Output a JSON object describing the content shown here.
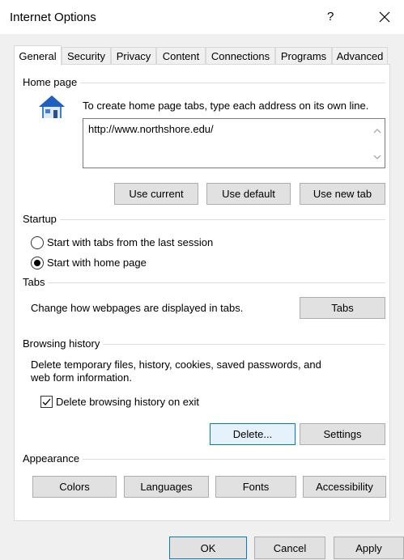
{
  "window": {
    "title": "Internet Options",
    "help_label": "?"
  },
  "tabs": [
    {
      "label": "General",
      "active": true
    },
    {
      "label": "Security"
    },
    {
      "label": "Privacy"
    },
    {
      "label": "Content"
    },
    {
      "label": "Connections"
    },
    {
      "label": "Programs"
    },
    {
      "label": "Advanced"
    }
  ],
  "home_page": {
    "group_label": "Home page",
    "instructions": "To create home page tabs, type each address on its own line.",
    "address_value": "http://www.northshore.edu/",
    "use_current": "Use current",
    "use_default": "Use default",
    "use_new_tab": "Use new tab"
  },
  "startup": {
    "group_label": "Startup",
    "option_last_session": "Start with tabs from the last session",
    "option_home_page": "Start with home page",
    "selected": "home_page"
  },
  "tabs_section": {
    "group_label": "Tabs",
    "description": "Change how webpages are displayed in tabs.",
    "button": "Tabs"
  },
  "browsing_history": {
    "group_label": "Browsing history",
    "description_line1": "Delete temporary files, history, cookies, saved passwords, and",
    "description_line2": "web form information.",
    "delete_on_exit_label": "Delete browsing history on exit",
    "delete_on_exit_checked": true,
    "delete_button": "Delete...",
    "settings_button": "Settings"
  },
  "appearance": {
    "group_label": "Appearance",
    "colors": "Colors",
    "languages": "Languages",
    "fonts": "Fonts",
    "accessibility": "Accessibility"
  },
  "footer": {
    "ok": "OK",
    "cancel": "Cancel",
    "apply": "Apply"
  },
  "colors": {
    "accent": "#0078d7",
    "button_face": "#e1e1e1",
    "panel_bg": "#ffffff",
    "window_bg": "#f0f0f0"
  }
}
